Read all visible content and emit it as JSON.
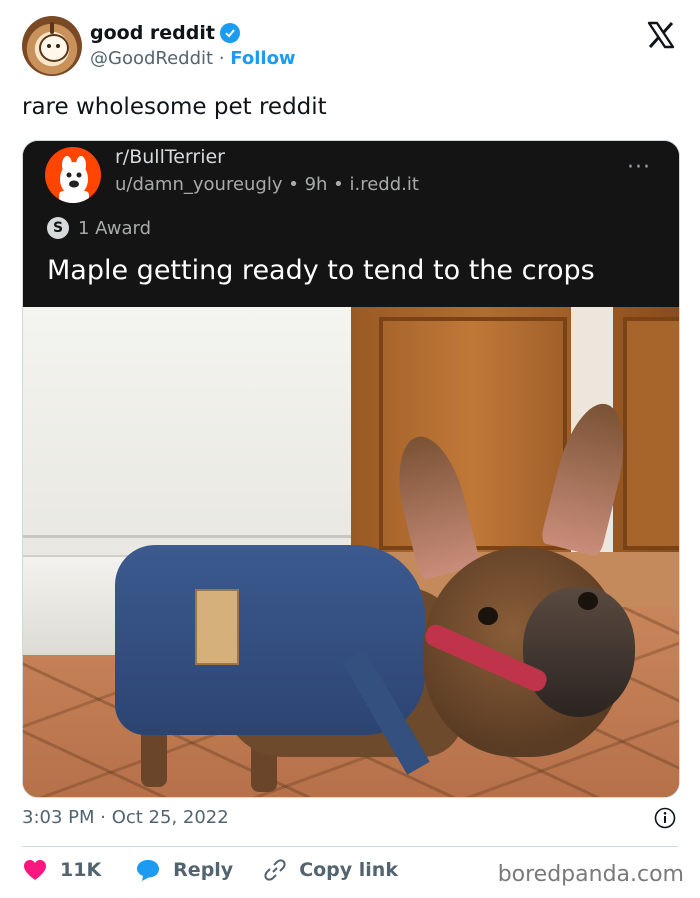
{
  "tweet": {
    "author_name": "good reddit",
    "handle": "@GoodReddit",
    "separator": "·",
    "follow_label": "Follow",
    "text": "rare wholesome pet reddit",
    "timestamp": "3:03 PM · Oct 25, 2022"
  },
  "reddit_post": {
    "subreddit": "r/BullTerrier",
    "meta": "u/damn_youreugly • 9h • i.redd.it",
    "more_icon": "···",
    "award_icon_label": "S",
    "award": "1 Award",
    "title": "Maple getting ready to tend to the crops"
  },
  "actions": {
    "like_count": "11K",
    "reply_label": "Reply",
    "copy_link_label": "Copy link"
  },
  "watermark": "boredpanda.com",
  "icons": {
    "x": "x-logo-icon",
    "verified": "verified-badge-icon",
    "info": "info-icon",
    "heart": "heart-icon",
    "reply": "reply-bubble-icon",
    "link": "link-icon"
  },
  "colors": {
    "accent": "#1d9bf0",
    "heart": "#f91880",
    "reddit_orange": "#ff4500",
    "reddit_header_bg": "#141414",
    "secondary_text": "#536471"
  }
}
